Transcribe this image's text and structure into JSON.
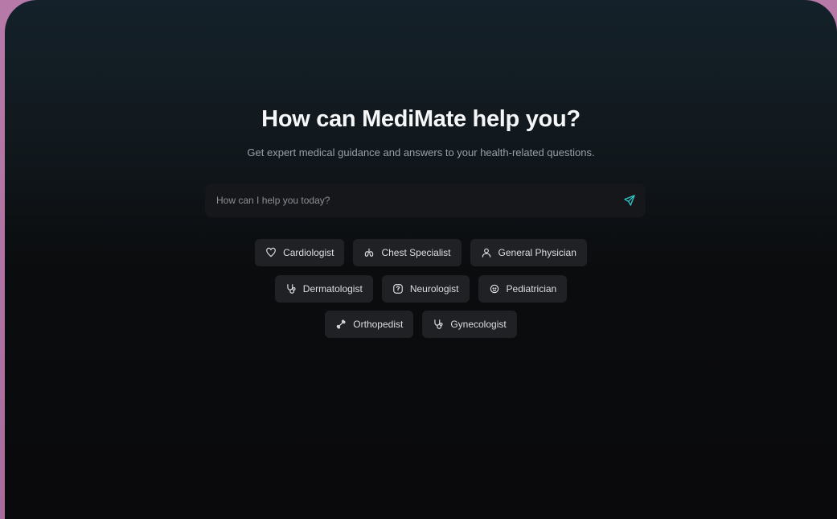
{
  "hero": {
    "title": "How can MediMate help you?",
    "subtitle": "Get expert medical guidance and answers to your health-related questions."
  },
  "search": {
    "placeholder": "How can I help you today?",
    "value": "",
    "send_icon": "send-icon",
    "accent_color": "#2ec4c7"
  },
  "chips": {
    "row1": [
      {
        "label": "Cardiologist",
        "icon": "heart-icon"
      },
      {
        "label": "Chest Specialist",
        "icon": "lungs-icon"
      },
      {
        "label": "General Physician",
        "icon": "user-icon"
      }
    ],
    "row2": [
      {
        "label": "Dermatologist",
        "icon": "stethoscope-icon"
      },
      {
        "label": "Neurologist",
        "icon": "brain-icon"
      },
      {
        "label": "Pediatrician",
        "icon": "baby-icon"
      }
    ],
    "row3": [
      {
        "label": "Orthopedist",
        "icon": "bone-icon"
      },
      {
        "label": "Gynecologist",
        "icon": "stethoscope-icon"
      }
    ]
  }
}
